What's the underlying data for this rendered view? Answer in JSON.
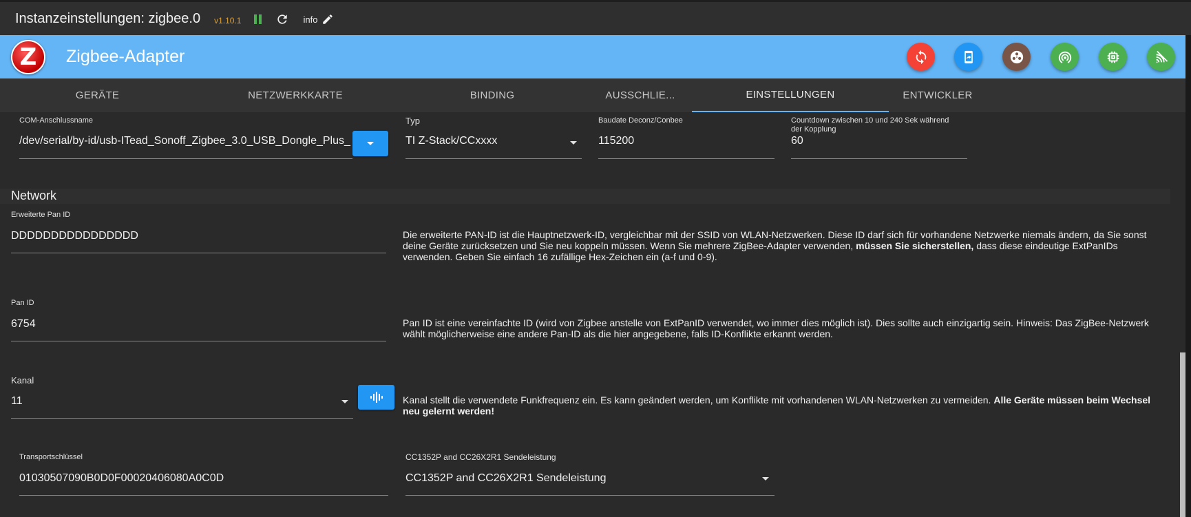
{
  "titlebar": {
    "title": "Instanzeinstellungen: zigbee.0",
    "version": "v1.10.1",
    "info_label": "info",
    "icons": [
      "pause-icon",
      "refresh-icon",
      "pencil-icon"
    ]
  },
  "header": {
    "title": "Zigbee-Adapter",
    "logo_letter": "Z",
    "buttons": [
      {
        "name": "reset-button",
        "icon": "sync-icon",
        "color": "#f44336"
      },
      {
        "name": "backup-button",
        "icon": "phone-download-icon",
        "color": "#2196f3"
      },
      {
        "name": "reel-button",
        "icon": "reel-icon",
        "color": "#795548"
      },
      {
        "name": "radar-button",
        "icon": "radar-icon",
        "color": "#4caf50"
      },
      {
        "name": "chip-button",
        "icon": "chip-icon",
        "color": "#4caf50"
      },
      {
        "name": "signal-button",
        "icon": "wifi-off-icon",
        "color": "#4caf50"
      }
    ]
  },
  "tabs": [
    {
      "label": "GERÄTE",
      "active": false
    },
    {
      "label": "NETZWERKKARTE",
      "active": false
    },
    {
      "label": "BINDING",
      "active": false
    },
    {
      "label": "AUSSCHLIE...",
      "active": false
    },
    {
      "label": "EINSTELLUNGEN",
      "active": true
    },
    {
      "label": "ENTWICKLER",
      "active": false
    }
  ],
  "fields": {
    "com_port": {
      "label": "COM-Anschlussname",
      "value": "/dev/serial/by-id/usb-ITead_Sonoff_Zigbee_3.0_USB_Dongle_Plus_"
    },
    "type": {
      "label": "Typ",
      "value": "TI Z-Stack/CCxxxx"
    },
    "baudrate": {
      "label": "Baudate Deconz/Conbee",
      "value": "115200"
    },
    "countdown": {
      "label_line1": "Countdown zwischen 10 und 240 Sek während",
      "label_line2": "der Kopplung",
      "value": "60"
    }
  },
  "network": {
    "section_title": "Network",
    "ext_pan_id": {
      "label": "Erweiterte Pan ID",
      "value": "DDDDDDDDDDDDDDDD",
      "desc_part1": "Die erweiterte PAN-ID ist die Hauptnetzwerk-ID, vergleichbar mit der SSID von WLAN-Netzwerken. Diese ID darf sich für vorhandene Netzwerke niemals ändern, da Sie sonst deine Geräte zurücksetzen und Sie neu koppeln müssen. Wenn Sie mehrere ZigBee-Adapter verwenden, ",
      "desc_bold": "müssen Sie sicherstellen,",
      "desc_part2": " dass diese eindeutige ExtPanIDs verwenden. Geben Sie einfach 16 zufällige Hex-Zeichen ein (a-f und 0-9)."
    },
    "pan_id": {
      "label": "Pan ID",
      "value": "6754",
      "desc": "Pan ID ist eine vereinfachte ID (wird von Zigbee anstelle von ExtPanID verwendet, wo immer dies möglich ist). Dies sollte auch einzigartig sein. Hinweis: Das ZigBee-Netzwerk wählt möglicherweise eine andere Pan-ID als die hier angegebene, falls ID-Konflikte erkannt werden."
    },
    "channel": {
      "label": "Kanal",
      "value": "11",
      "desc_part1": "Kanal stellt die verwendete Funkfrequenz ein. Es kann geändert werden, um Konflikte mit vorhandenen WLAN-Netzwerken zu vermeiden. ",
      "desc_bold": "Alle Geräte müssen beim Wechsel neu gelernt werden!"
    },
    "transport_key": {
      "label": "Transportschlüssel",
      "value": "01030507090B0D0F00020406080A0C0D"
    },
    "tx_power": {
      "label": "CC1352P and CC26X2R1 Sendeleistung",
      "value": "CC1352P and CC26X2R1 Sendeleistung"
    }
  }
}
